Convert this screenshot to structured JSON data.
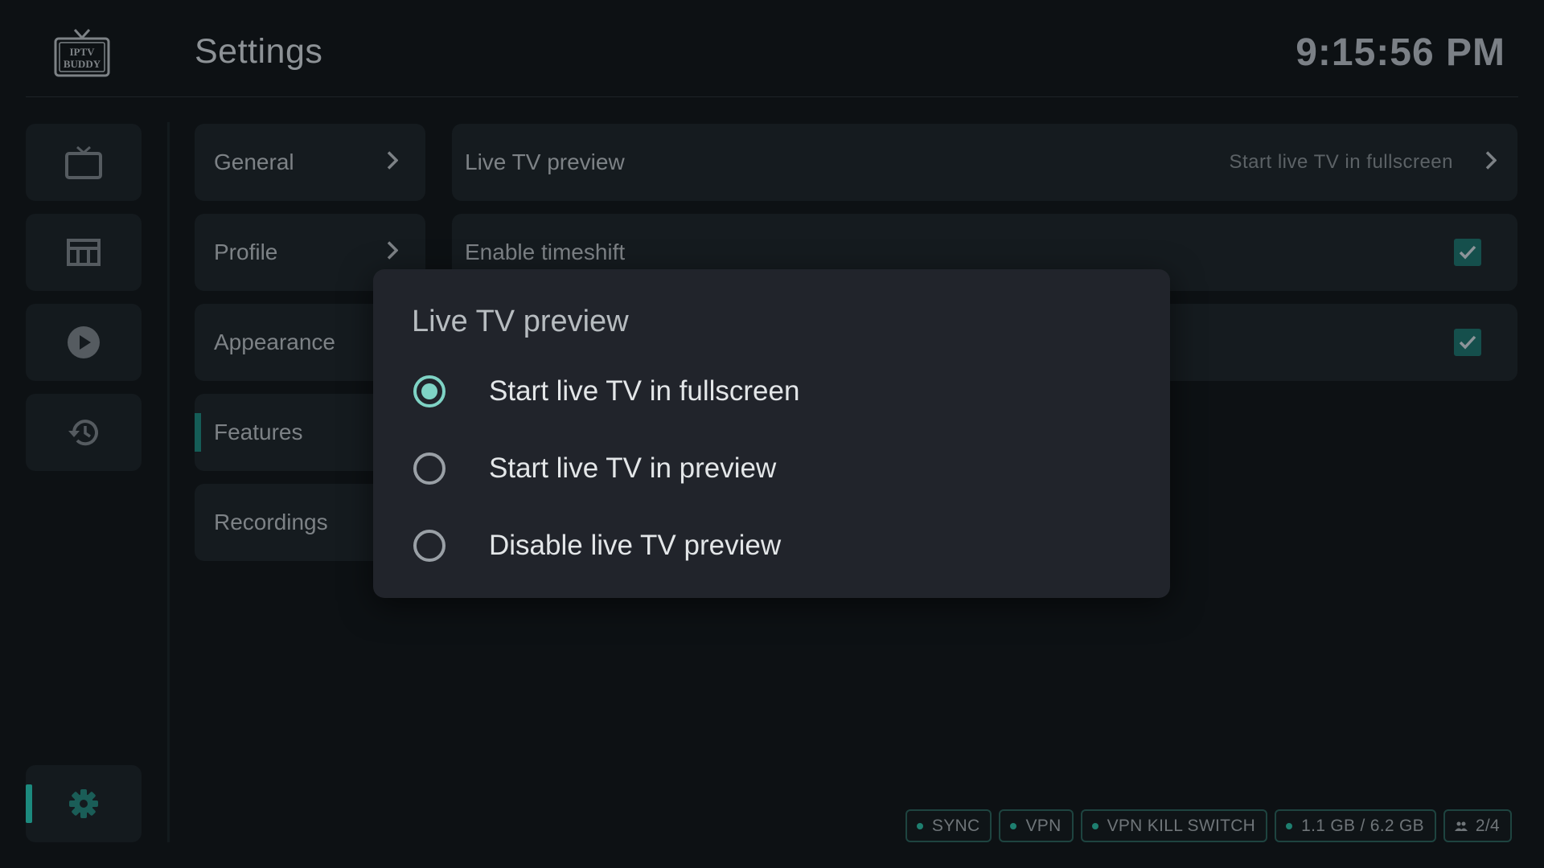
{
  "header": {
    "logo_text_line1": "IPTV",
    "logo_text_line2": "BUDDY",
    "title": "Settings",
    "clock": "9:15:56 PM"
  },
  "rail": {
    "items": [
      {
        "icon": "tv-icon"
      },
      {
        "icon": "epg-grid-icon"
      },
      {
        "icon": "play-circle-icon"
      },
      {
        "icon": "history-icon"
      },
      {
        "icon": "gear-icon",
        "active": true
      }
    ]
  },
  "categories": [
    {
      "label": "General",
      "has_chevron": true
    },
    {
      "label": "Profile",
      "has_chevron": true
    },
    {
      "label": "Appearance"
    },
    {
      "label": "Features",
      "active": true
    },
    {
      "label": "Recordings"
    }
  ],
  "settings": {
    "rows": [
      {
        "label": "Live TV preview",
        "value": "Start live TV in fullscreen"
      },
      {
        "label": "Enable timeshift",
        "checked": true
      },
      {
        "checked": true
      }
    ]
  },
  "dialog": {
    "title": "Live TV preview",
    "options": [
      {
        "label": "Start live TV in fullscreen",
        "selected": true
      },
      {
        "label": "Start live TV in preview",
        "selected": false
      },
      {
        "label": "Disable live TV preview",
        "selected": false
      }
    ]
  },
  "status": {
    "pills": [
      {
        "label": "SYNC"
      },
      {
        "label": "VPN"
      },
      {
        "label": "VPN KILL SWITCH"
      },
      {
        "label": "1.1 GB / 6.2 GB"
      },
      {
        "label": "2/4",
        "icon": "people-icon"
      }
    ]
  },
  "colors": {
    "background": "#0d1114",
    "accent": "#7fd3c5",
    "dialog": "#21242b"
  }
}
